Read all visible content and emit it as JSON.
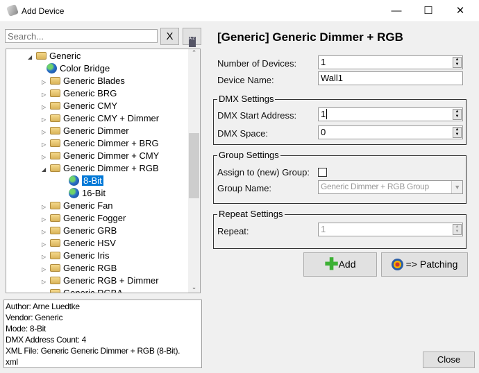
{
  "window": {
    "title": "Add Device",
    "minimize": "—",
    "maximize": "☐",
    "close": "✕"
  },
  "search": {
    "placeholder": "Search...",
    "clear_label": "X",
    "sort_label": "A-Z"
  },
  "tree": [
    {
      "label": "Generic",
      "type": "folder",
      "level": 0,
      "expanded": true
    },
    {
      "label": "Color Bridge",
      "type": "device",
      "level": 1
    },
    {
      "label": "Generic Blades",
      "type": "folder",
      "level": 1
    },
    {
      "label": "Generic BRG",
      "type": "folder",
      "level": 1
    },
    {
      "label": "Generic CMY",
      "type": "folder",
      "level": 1
    },
    {
      "label": "Generic CMY + Dimmer",
      "type": "folder",
      "level": 1
    },
    {
      "label": "Generic Dimmer",
      "type": "folder",
      "level": 1
    },
    {
      "label": "Generic Dimmer + BRG",
      "type": "folder",
      "level": 1
    },
    {
      "label": "Generic Dimmer + CMY",
      "type": "folder",
      "level": 1
    },
    {
      "label": "Generic Dimmer + RGB",
      "type": "folder",
      "level": 1,
      "expanded": true
    },
    {
      "label": "8-Bit",
      "type": "mode",
      "level": 2,
      "selected": true
    },
    {
      "label": "16-Bit",
      "type": "mode",
      "level": 2
    },
    {
      "label": "Generic Fan",
      "type": "folder",
      "level": 1
    },
    {
      "label": "Generic Fogger",
      "type": "folder",
      "level": 1
    },
    {
      "label": "Generic GRB",
      "type": "folder",
      "level": 1
    },
    {
      "label": "Generic HSV",
      "type": "folder",
      "level": 1
    },
    {
      "label": "Generic Iris",
      "type": "folder",
      "level": 1
    },
    {
      "label": "Generic RGB",
      "type": "folder",
      "level": 1
    },
    {
      "label": "Generic RGB + Dimmer",
      "type": "folder",
      "level": 1
    },
    {
      "label": "Generic RGBA",
      "type": "folder",
      "level": 1
    }
  ],
  "info": [
    "Author: Arne Luedtke",
    "Vendor: Generic",
    "Mode: 8-Bit",
    "DMX Address Count: 4",
    "XML File: Generic Generic Dimmer + RGB (8-Bit).",
    "xml"
  ],
  "heading": "[Generic] Generic Dimmer + RGB",
  "form": {
    "num_devices_label": "Number of Devices:",
    "num_devices": "1",
    "device_name_label": "Device Name:",
    "device_name": "Wall1",
    "dmx_group": "DMX Settings",
    "start_label": "DMX Start Address:",
    "start": "1",
    "space_label": "DMX Space:",
    "space": "0",
    "group_group": "Group Settings",
    "assign_label": "Assign to (new) Group:",
    "assign_checked": false,
    "group_name_label": "Group Name:",
    "group_name": "Generic Dimmer + RGB Group",
    "repeat_group": "Repeat Settings",
    "repeat_label": "Repeat:",
    "repeat": "1"
  },
  "buttons": {
    "add": "Add",
    "patching": "=> Patching",
    "close": "Close"
  }
}
